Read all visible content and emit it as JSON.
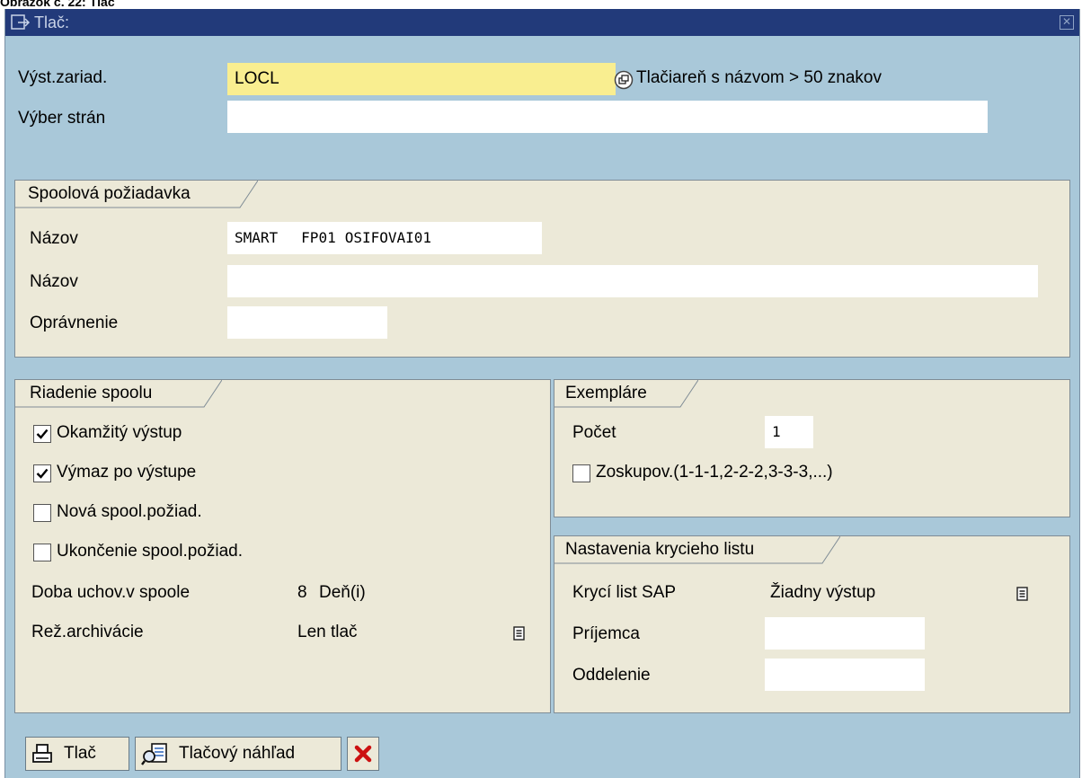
{
  "caption": "Obrázok č. 22: Tlač",
  "window": {
    "title": "Tlač:"
  },
  "top": {
    "output_device_label": "Výst.zariad.",
    "output_device_value": "LOCL",
    "output_device_hint": "Tlačiareň s názvom > 50 znakov",
    "page_selection_label": "Výber strán",
    "page_selection_value": ""
  },
  "spool_request": {
    "title": "Spoolová požiadavka",
    "name_label": "Názov",
    "name_part1": "SMART",
    "name_part2": "FP01",
    "name_part3": "OSIFOVAI01",
    "name2_label": "Názov",
    "name2_value": "",
    "auth_label": "Oprávnenie",
    "auth_value": ""
  },
  "spool_control": {
    "title": "Riadenie spoolu",
    "items": [
      {
        "label": "Okamžitý výstup",
        "checked": true
      },
      {
        "label": "Výmaz po výstupe",
        "checked": true
      },
      {
        "label": "Nová spool.požiad.",
        "checked": false
      },
      {
        "label": "Ukončenie spool.požiad.",
        "checked": false
      }
    ],
    "retention_label": "Doba uchov.v spoole",
    "retention_value": "8",
    "retention_unit": "Deň(i)",
    "archive_label": "Rež.archivácie",
    "archive_value": "Len tlač"
  },
  "copies": {
    "title": "Exempláre",
    "count_label": "Počet",
    "count_value": "1",
    "group_label": "Zoskupov.(1-1-1,2-2-2,3-3-3,...)",
    "group_checked": false
  },
  "cover_sheet": {
    "title": "Nastavenia krycieho listu",
    "sap_label": "Krycí list SAP",
    "sap_value": "Žiadny výstup",
    "recipient_label": "Príjemca",
    "recipient_value": "",
    "department_label": "Oddelenie",
    "department_value": ""
  },
  "toolbar": {
    "print_label": "Tlač",
    "preview_label": "Tlačový náhľad",
    "cancel_icon": "red-x-icon"
  },
  "colors": {
    "titlebar": "#223a7a",
    "background": "#a9c8d9",
    "group_bg": "#ece9d8",
    "required_field": "#f9ee90",
    "cancel_red": "#cc1111"
  }
}
